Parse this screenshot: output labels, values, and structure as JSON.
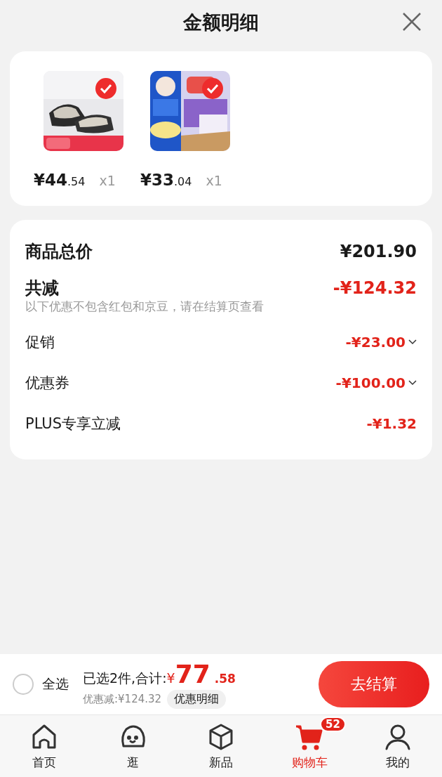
{
  "header": {
    "title": "金额明细"
  },
  "products": [
    {
      "selected": true,
      "price_main": "¥44",
      "price_cents": ".54",
      "quantity": "x1"
    },
    {
      "selected": true,
      "price_main": "¥33",
      "price_cents": ".04",
      "quantity": "x1"
    }
  ],
  "breakdown": [
    {
      "kind": "total",
      "label": "商品总价",
      "amount": "¥201.90"
    },
    {
      "kind": "reduction",
      "label": "共减",
      "amount": "-¥124.32",
      "note": "以下优惠不包含红包和京豆，请在结算页查看"
    },
    {
      "kind": "detail",
      "label": "促销",
      "amount": "-¥23.00",
      "expandable": true
    },
    {
      "kind": "detail",
      "label": "优惠券",
      "amount": "-¥100.00",
      "expandable": true
    },
    {
      "kind": "detail",
      "label": "PLUS专享立减",
      "amount": "-¥1.32",
      "expandable": false
    }
  ],
  "checkout_bar": {
    "select_all": {
      "label": "全选",
      "checked": false
    },
    "summary": "已选2件,合计:",
    "currency": "¥",
    "total_main": "77",
    "total_cents": ".58",
    "discount": "优惠减:¥124.32",
    "details_button": "优惠明细",
    "checkout_button": "去结算"
  },
  "tab_bar": [
    {
      "label": "首页",
      "selected": false
    },
    {
      "label": "逛",
      "selected": false
    },
    {
      "label": "新品",
      "selected": false
    },
    {
      "label": "购物车",
      "selected": true,
      "badge": "52"
    },
    {
      "label": "我的",
      "selected": false
    }
  ]
}
